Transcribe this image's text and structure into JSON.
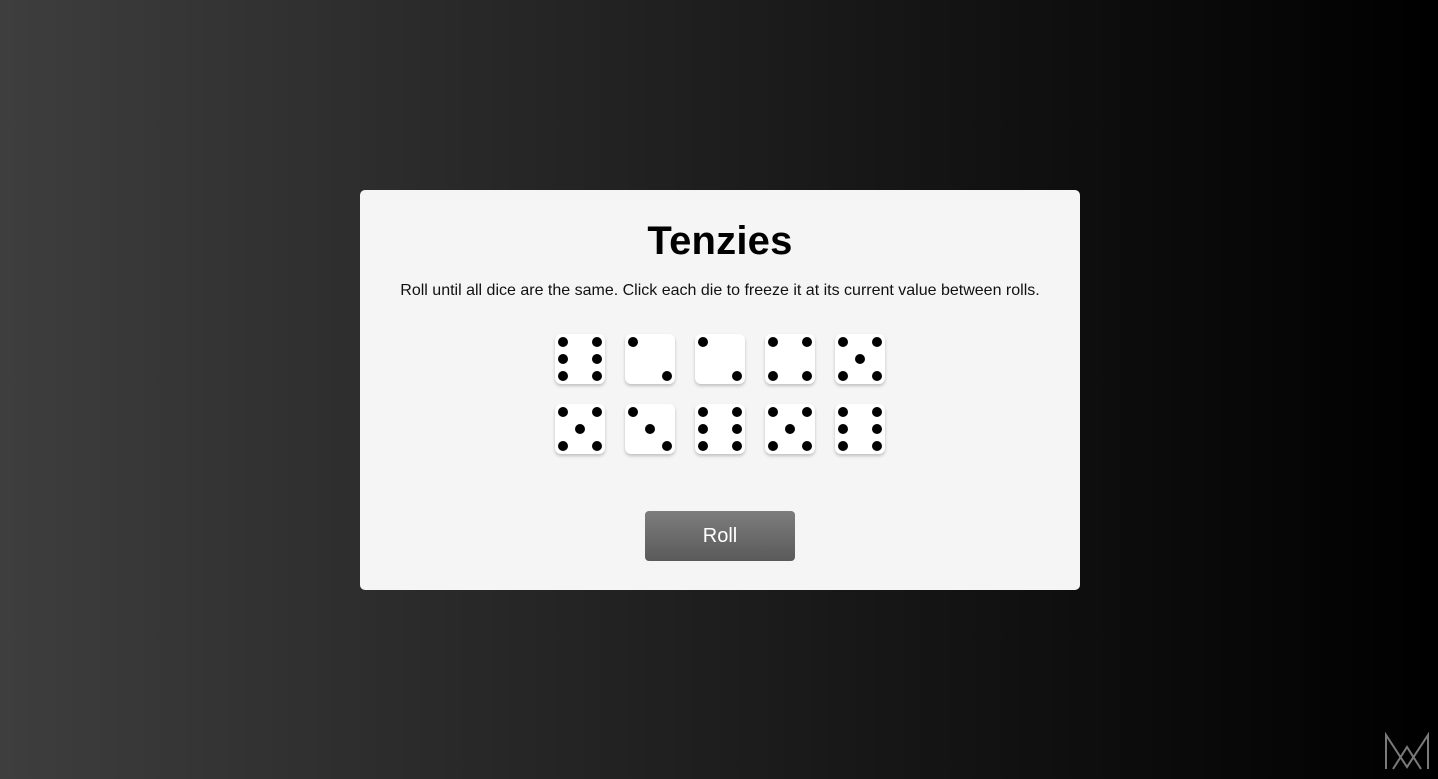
{
  "game": {
    "title": "Tenzies",
    "instructions": "Roll until all dice are the same. Click each die to freeze it at its current value between rolls.",
    "dice": [
      6,
      2,
      2,
      4,
      5,
      5,
      3,
      6,
      5,
      6
    ],
    "roll_label": "Roll"
  },
  "icons": {
    "logo": "m-logo-icon"
  }
}
